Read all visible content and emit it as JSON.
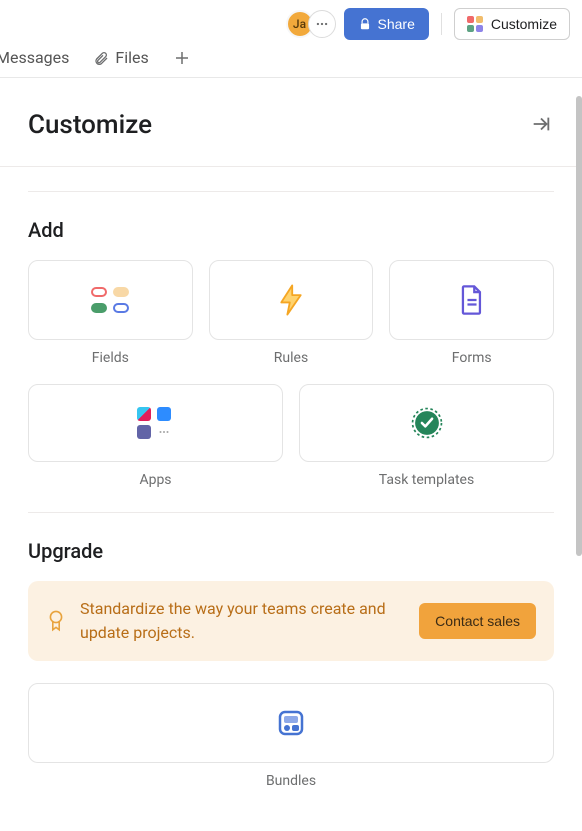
{
  "header": {
    "avatar_initials": "Ja",
    "share_label": "Share",
    "customize_label": "Customize"
  },
  "tabs": {
    "messages_label": "Messages",
    "files_label": "Files"
  },
  "panel": {
    "title": "Customize"
  },
  "sections": {
    "add": {
      "title": "Add",
      "cards": {
        "fields": "Fields",
        "rules": "Rules",
        "forms": "Forms",
        "apps": "Apps",
        "task_templates": "Task templates"
      }
    },
    "upgrade": {
      "title": "Upgrade",
      "banner_text": "Standardize the way your teams create and update projects.",
      "cta_label": "Contact sales",
      "cards": {
        "bundles": "Bundles"
      }
    }
  }
}
